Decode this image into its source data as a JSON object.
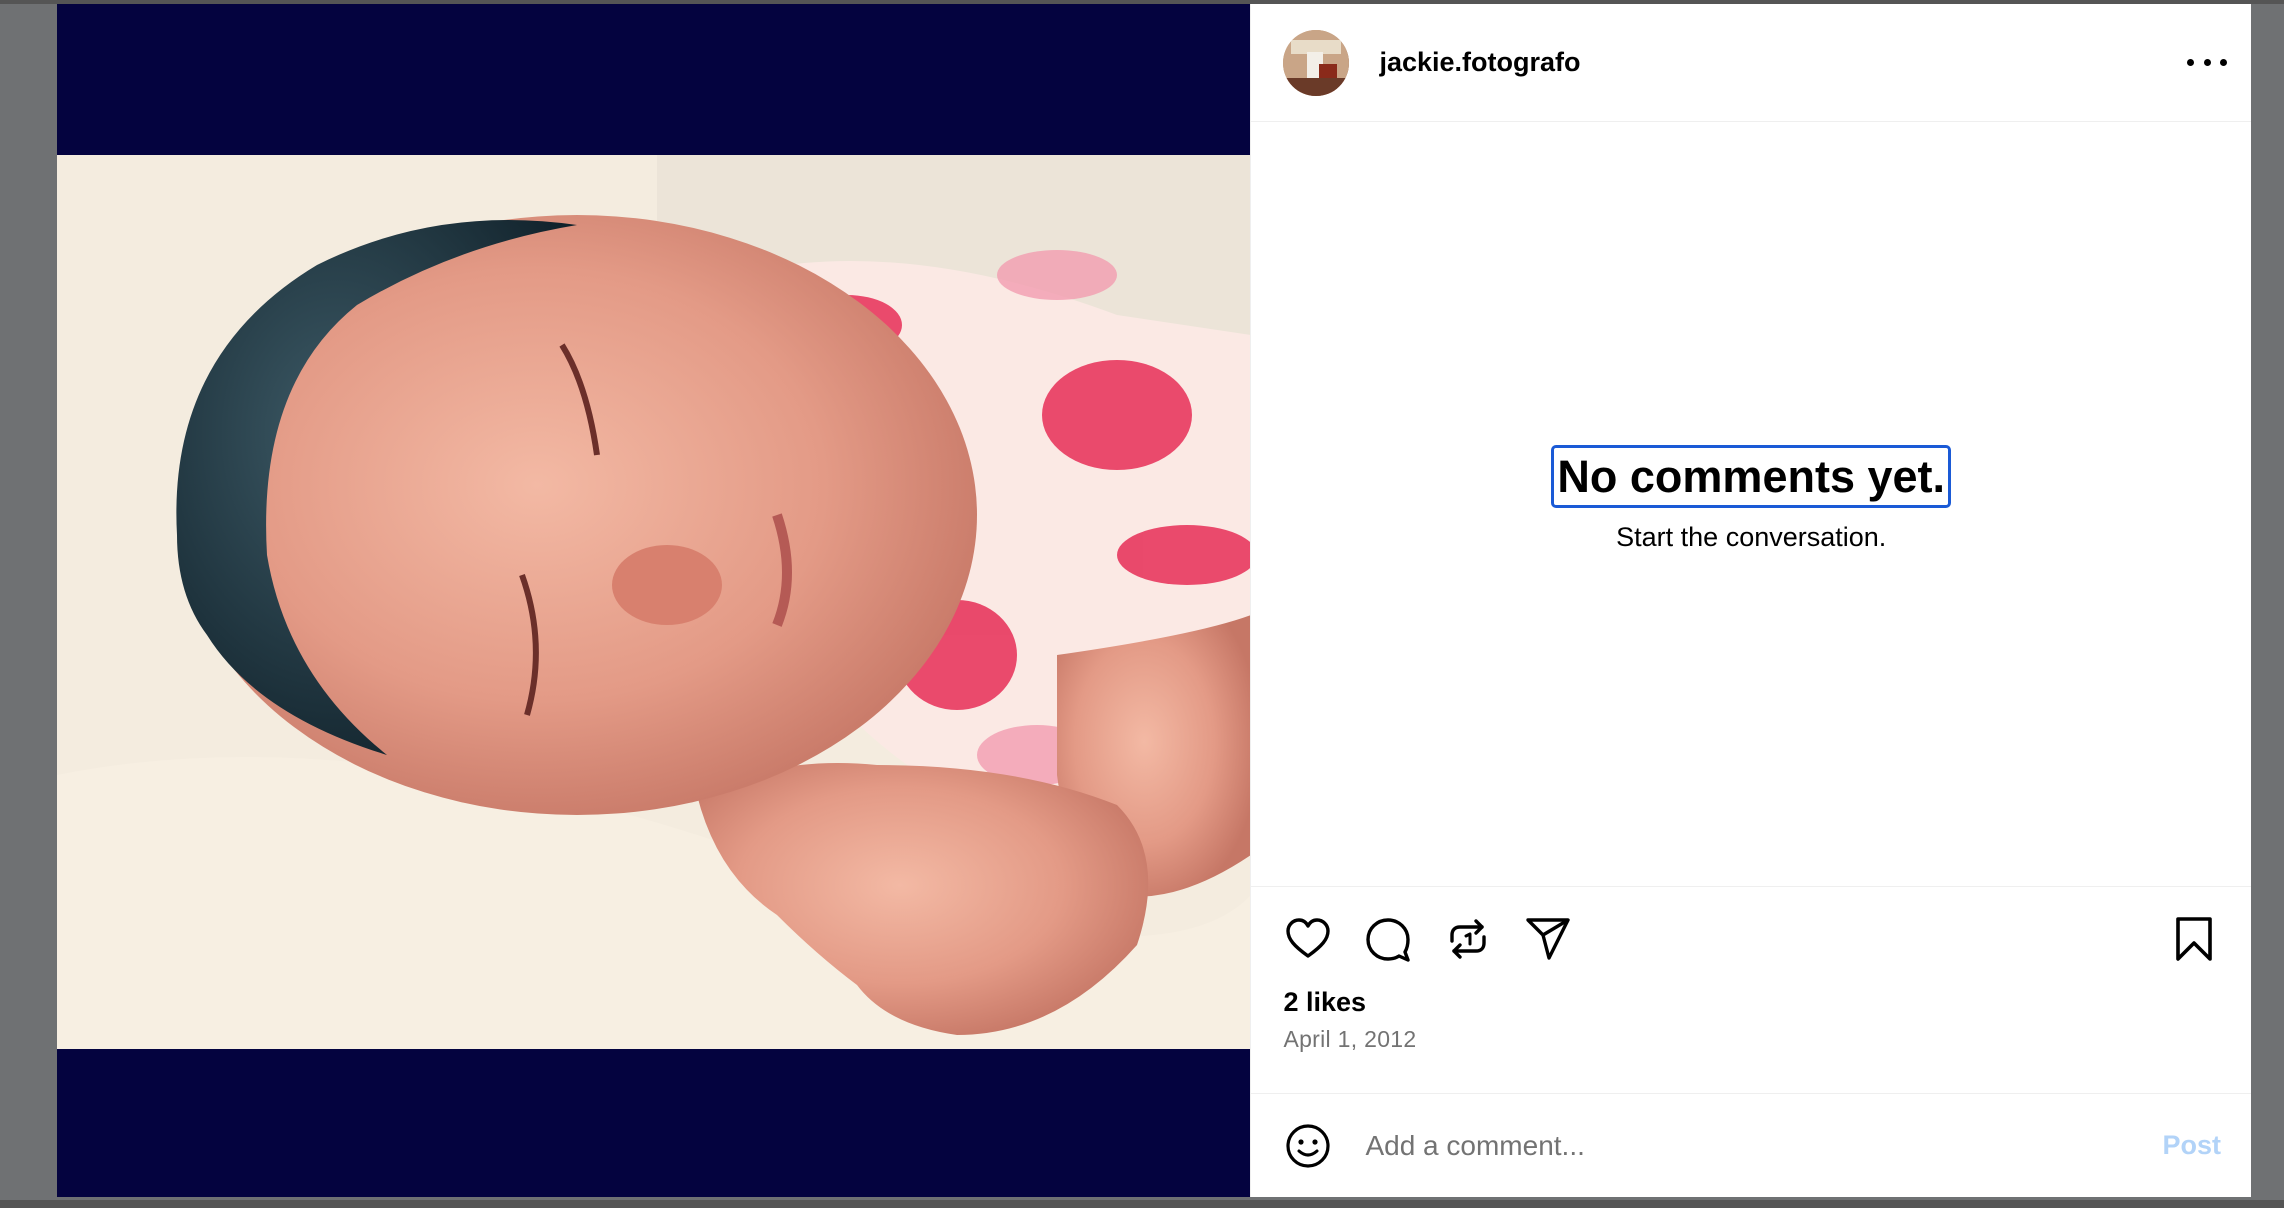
{
  "post": {
    "username": "jackie.fotografo",
    "avatar_icon": "avatar-photo",
    "more_icon": "more-options-icon"
  },
  "comments": {
    "empty_title": "No comments yet.",
    "empty_subtitle": "Start the conversation."
  },
  "actions": {
    "like_icon": "heart-icon",
    "comment_icon": "comment-icon",
    "repost_icon": "repost-icon",
    "share_icon": "share-icon",
    "save_icon": "bookmark-icon",
    "likes_text": "2 likes",
    "date_text": "April 1, 2012"
  },
  "composer": {
    "placeholder": "Add a comment...",
    "post_label": "Post"
  },
  "colors": {
    "letterbox": "#04033f",
    "focus_ring": "#1a5ad6",
    "post_disabled": "#b2d3f8"
  }
}
